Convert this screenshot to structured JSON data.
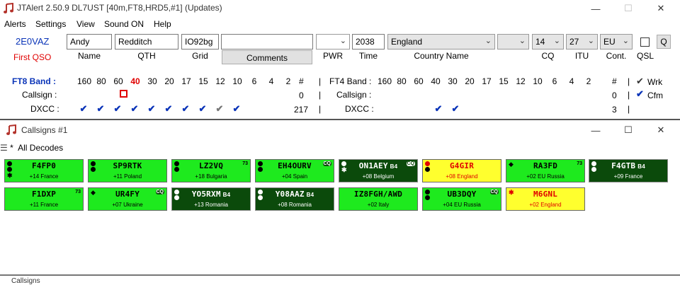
{
  "window": {
    "title": "JTAlert 2.50.9 DL7UST [40m,FT8,HRD5,#1] (Updates)",
    "icon": "music-note-icon",
    "controls": [
      "—",
      "☐",
      "✕"
    ]
  },
  "menu": [
    "Alerts",
    "Settings",
    "View",
    "Sound ON",
    "Help"
  ],
  "entry": {
    "callsign": "2E0VAZ",
    "first_qso": "First QSO",
    "name": "Andy",
    "name_label": "Name",
    "qth": "Redditch",
    "qth_label": "QTH",
    "grid": "IO92bg",
    "grid_label": "Grid",
    "comments_value": "",
    "comments_button": "Comments",
    "pwr": "",
    "pwr_label": "PWR",
    "time": "2038",
    "time_label": "Time",
    "country": "England",
    "country_label": "Country Name",
    "extra_dd": "",
    "cq": "14",
    "cq_label": "CQ",
    "itu": "27",
    "itu_label": "ITU",
    "cont": "EU",
    "cont_label": "Cont.",
    "qsl_label": "QSL",
    "q_button": "Q"
  },
  "ft8": {
    "band_label": "FT8 Band :",
    "bands": [
      "160",
      "80",
      "60",
      "40",
      "30",
      "20",
      "17",
      "15",
      "12",
      "10",
      "6",
      "4",
      "2"
    ],
    "active_band": "40",
    "hash": "#",
    "callsign_label": "Callsign :",
    "callsign_count": "0",
    "dxcc_label": "DXCC :",
    "dxcc_count": "217"
  },
  "ft4": {
    "band_label": "FT4 Band :",
    "bands": [
      "160",
      "80",
      "60",
      "40",
      "30",
      "20",
      "17",
      "15",
      "12",
      "10",
      "6",
      "4",
      "2"
    ],
    "hash": "#",
    "callsign_label": "Callsign :",
    "callsign_count": "0",
    "dxcc_label": "DXCC :",
    "dxcc_count": "3"
  },
  "legend": {
    "wrk": "Wrk",
    "cfm": "Cfm"
  },
  "callsigns_window": {
    "title": "Callsigns #1",
    "filter": "All Decodes",
    "controls": [
      "—",
      "☐",
      "✕"
    ]
  },
  "tiles": [
    {
      "call": "F4FP0",
      "info": "+14 France",
      "style": "green",
      "sub": "",
      "badge": ""
    },
    {
      "call": "SP9RTK",
      "info": "+11 Poland",
      "style": "green",
      "sub": "",
      "badge": ""
    },
    {
      "call": "LZ2VQ",
      "info": "+18 Bulgaria",
      "style": "green",
      "sub": "",
      "badge": "73"
    },
    {
      "call": "EH4OURV",
      "info": "+04 Spain",
      "style": "green",
      "sub": "",
      "badge": "CQ"
    },
    {
      "call": "ON1AEY",
      "info": "+08 Belgium",
      "style": "dark",
      "sub": "B4",
      "badge": "CQ"
    },
    {
      "call": "G4GIR",
      "info": "+08 England",
      "style": "yellow",
      "sub": "",
      "badge": ""
    },
    {
      "call": "RA3FD",
      "info": "+02 EU Russia",
      "style": "green",
      "sub": "",
      "badge": "73"
    },
    {
      "call": "F4GTB",
      "info": "+09 France",
      "style": "dark",
      "sub": "B4",
      "badge": ""
    },
    {
      "call": "F1DXP",
      "info": "+11 France",
      "style": "green",
      "sub": "",
      "badge": "73"
    },
    {
      "call": "UR4FY",
      "info": "+07 Ukraine",
      "style": "green",
      "sub": "",
      "badge": "CQ"
    },
    {
      "call": "YO5RXM",
      "info": "+13 Romania",
      "style": "dark",
      "sub": "B4",
      "badge": ""
    },
    {
      "call": "Y08AAZ",
      "info": "+08 Romania",
      "style": "dark",
      "sub": "B4",
      "badge": ""
    },
    {
      "call": "IZ8FGH/AWD",
      "info": "+02 Italy",
      "style": "green",
      "sub": "",
      "badge": ""
    },
    {
      "call": "UB3DQY",
      "info": "+04 EU Russia",
      "style": "green",
      "sub": "",
      "badge": "CQ"
    },
    {
      "call": "M6GNL",
      "info": "+02 England",
      "style": "yellow",
      "sub": "",
      "badge": ""
    }
  ],
  "colors": {
    "tile_green": "#1eea1e",
    "tile_dark": "#0b4a0b",
    "tile_yellow": "#ffff2e",
    "call_red": "#e00000",
    "accent_blue": "#0a34b8"
  },
  "bottom_title": "Callsigns"
}
